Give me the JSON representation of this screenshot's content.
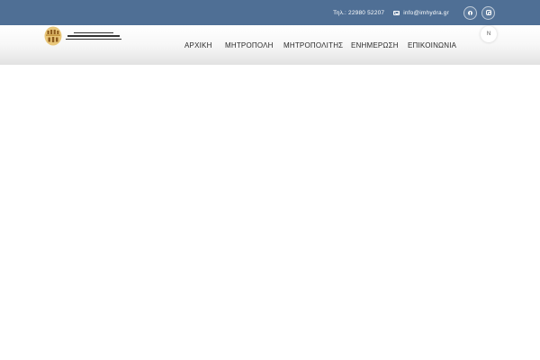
{
  "topbar": {
    "phone": "Τηλ.: 22980 52207",
    "email": "info@imhydra.gr",
    "icons": [
      "mail-icon",
      "facebook-icon",
      "instagram-icon"
    ],
    "background_color": "#4f6f95"
  },
  "header": {
    "logo_name": "logo",
    "nav": [
      {
        "label": "ΑΡΧΙΚΗ"
      },
      {
        "label": "ΜΗΤΡΟΠΟΛΗ"
      },
      {
        "label": "ΜΗΤΡΟΠΟΛΙΤΗΣ"
      },
      {
        "label": "ΕΝΗΜΕΡΩΣΗ"
      },
      {
        "label": "ΕΠΙΚΟΙΝΩΝΙΑ"
      }
    ],
    "language_toggle": "N"
  }
}
